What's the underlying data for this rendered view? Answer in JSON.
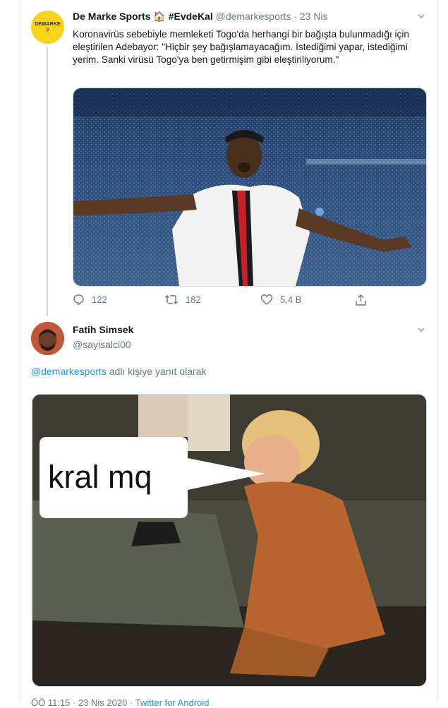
{
  "tweet1": {
    "display_name": "De Marke Sports 🏠 #EvdeKal",
    "handle": "@demarkesports",
    "dot": "·",
    "date": "23 Nis",
    "avatar_text": "DEMARKE",
    "avatar_subtext": "Ş",
    "text": "Koronavirüs sebebiyle memleketi Togo'da herhangi bir bağışta bulunmadığı için eleştirilen Adebayor: \"Hiçbir şey bağışlamayacağım. İstediğimi yapar, istediğimi yerim. Sanki virüsü Togo'ya ben getirmişim gibi eleştiriliyorum.\"",
    "replies": "122",
    "retweets": "182",
    "likes": "5,4 B"
  },
  "tweet2": {
    "display_name": "Fatih Simsek",
    "handle": "@sayisalci00",
    "reply_to_handle": "@demarkesports",
    "reply_to_suffix": " adlı kişiye yanıt olarak",
    "meme_text": "kral mq",
    "footer_time": "ÖÖ 11:15 · 23 Nis 2020 · ",
    "footer_source": "Twitter for Android"
  },
  "colors": {
    "accent": "#1b95e0",
    "muted": "#657786",
    "border": "#e6ecf0"
  }
}
